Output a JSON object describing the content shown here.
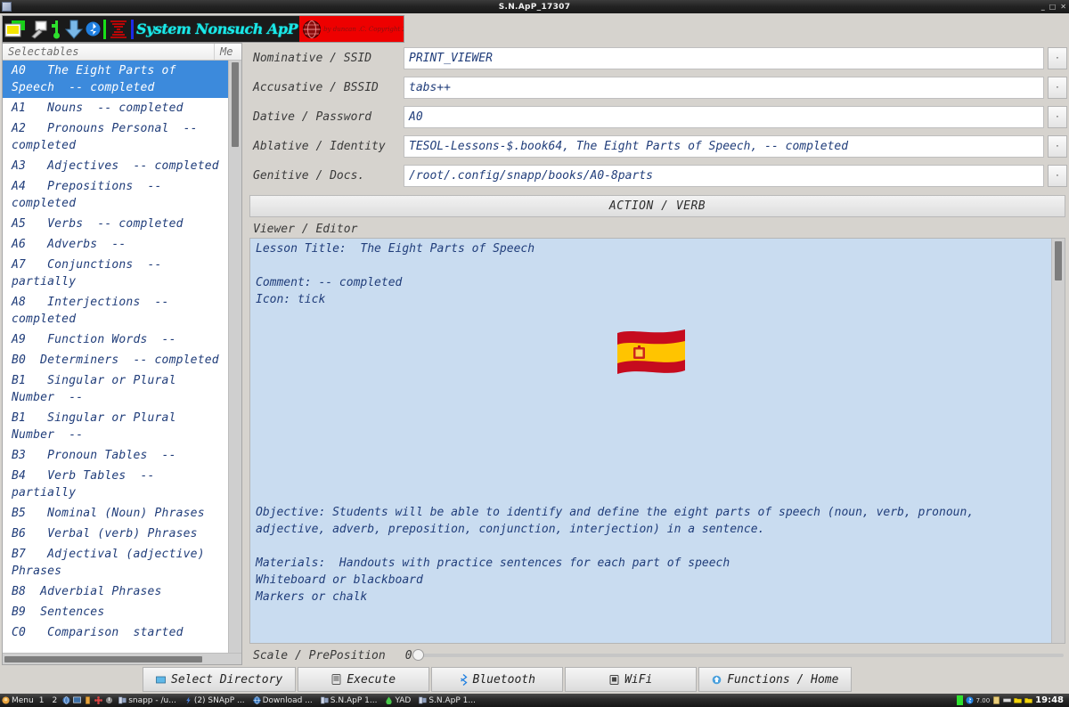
{
  "window": {
    "title": "S.N.ApP_17307",
    "min_label": "_",
    "max_label": "□",
    "close_label": "✕"
  },
  "banner": {
    "app_name": "System Nonsuch ApP",
    "copyright": "by duncan .C. Copyright 2020",
    "icons": [
      "folder-icon",
      "pen-icon",
      "usb-icon",
      "download-arrow-icon",
      "bluetooth-icon",
      "signal-icon",
      "globe-icon",
      "monitor-icon"
    ]
  },
  "list_panel": {
    "header_selectables": "Selectables",
    "header_meta": "Me",
    "items": [
      {
        "label": "A0   The Eight Parts of Speech  -- completed",
        "selected": true
      },
      {
        "label": "A1   Nouns  -- completed",
        "selected": false
      },
      {
        "label": "A2   Pronouns Personal  -- completed",
        "selected": false
      },
      {
        "label": "A3   Adjectives  -- completed",
        "selected": false
      },
      {
        "label": "A4   Prepositions  -- completed",
        "selected": false
      },
      {
        "label": "A5   Verbs  -- completed",
        "selected": false
      },
      {
        "label": "A6   Adverbs  --",
        "selected": false
      },
      {
        "label": "A7   Conjunctions  -- partially",
        "selected": false
      },
      {
        "label": "A8   Interjections  -- completed",
        "selected": false
      },
      {
        "label": "A9   Function Words  --",
        "selected": false
      },
      {
        "label": "B0  Determiners  -- completed",
        "selected": false
      },
      {
        "label": "B1   Singular or Plural Number  --",
        "selected": false
      },
      {
        "label": "B1   Singular or Plural Number  --",
        "selected": false
      },
      {
        "label": "B3   Pronoun Tables  --",
        "selected": false
      },
      {
        "label": "B4   Verb Tables  -- partially",
        "selected": false
      },
      {
        "label": "B5   Nominal (Noun) Phrases",
        "selected": false
      },
      {
        "label": "B6   Verbal (verb) Phrases",
        "selected": false
      },
      {
        "label": "B7   Adjectival (adjective) Phrases",
        "selected": false
      },
      {
        "label": "B8  Adverbial Phrases",
        "selected": false
      },
      {
        "label": "B9  Sentences",
        "selected": false
      },
      {
        "label": "C0   Comparison  started",
        "selected": false
      }
    ]
  },
  "form": {
    "rows": [
      {
        "label": "Nominative / SSID",
        "value": "PRINT_VIEWER",
        "dropdown": "·"
      },
      {
        "label": "Accusative / BSSID",
        "value": "tabs++",
        "dropdown": "·"
      },
      {
        "label": "Dative / Password",
        "value": "A0",
        "dropdown": "·"
      },
      {
        "label": "Ablative / Identity",
        "value": "TESOL-Lessons-$.book64,   The Eight Parts of Speech,  -- completed",
        "dropdown": "·"
      },
      {
        "label": "Genitive / Docs.",
        "value": "/root/.config/snapp/books/A0-8parts",
        "dropdown": "·"
      }
    ],
    "action_button": "ACTION / VERB"
  },
  "viewer": {
    "label": "Viewer / Editor",
    "lines_top": [
      "Lesson Title:  The Eight Parts of Speech",
      "",
      "Comment: -- completed",
      "Icon: tick"
    ],
    "image": "spain-flag-emoji",
    "lines_bottom": [
      "Objective: Students will be able to identify and define the eight parts of speech (noun, verb, pronoun,",
      "adjective, adverb, preposition, conjunction, interjection) in a sentence.",
      "",
      "Materials:  Handouts with practice sentences for each part of speech",
      "Whiteboard or blackboard",
      "Markers or chalk"
    ]
  },
  "slider": {
    "label": "Scale / PrePosition",
    "value": "0"
  },
  "buttons": [
    {
      "label": "Select Directory",
      "icon": "folder-icon"
    },
    {
      "label": "Execute",
      "icon": "terminal-icon"
    },
    {
      "label": "Bluetooth",
      "icon": "bluetooth-icon"
    },
    {
      "label": "WiFi",
      "icon": "wifi-icon"
    },
    {
      "label": "Functions / Home",
      "icon": "home-icon"
    }
  ],
  "taskbar": {
    "menu_label": "Menu",
    "desktops": [
      "1",
      "2"
    ],
    "tray_icons": [
      "globe-icon",
      "display-icon",
      "battery-icon",
      "pinwheel-icon",
      "power-icon"
    ],
    "windows": [
      {
        "label": "snapp - /u...",
        "icon": "app-icon"
      },
      {
        "label": "(2) SNApP ...",
        "icon": "bolt-icon"
      },
      {
        "label": "Download ...",
        "icon": "globe-icon"
      },
      {
        "label": "S.N.ApP 1...",
        "icon": "app-icon"
      },
      {
        "label": "YAD",
        "icon": "drop-icon"
      },
      {
        "label": "S.N.ApP 1...",
        "icon": "app-icon"
      }
    ],
    "right_items": [
      "green-bar-icon",
      "bluetooth-icon",
      "7.00",
      "clipboard-icon",
      "keyboard-icon",
      "folder-icon",
      "folder-icon"
    ],
    "cpu_label": "7.00",
    "clock": "19:48"
  },
  "colors": {
    "selection_blue": "#3c8adc",
    "text_blue": "#203d7a",
    "editor_bg": "#c9dcf0",
    "window_bg": "#d6d3ce",
    "banner_red": "#ee0000",
    "banner_cyan": "#19e7e7"
  }
}
